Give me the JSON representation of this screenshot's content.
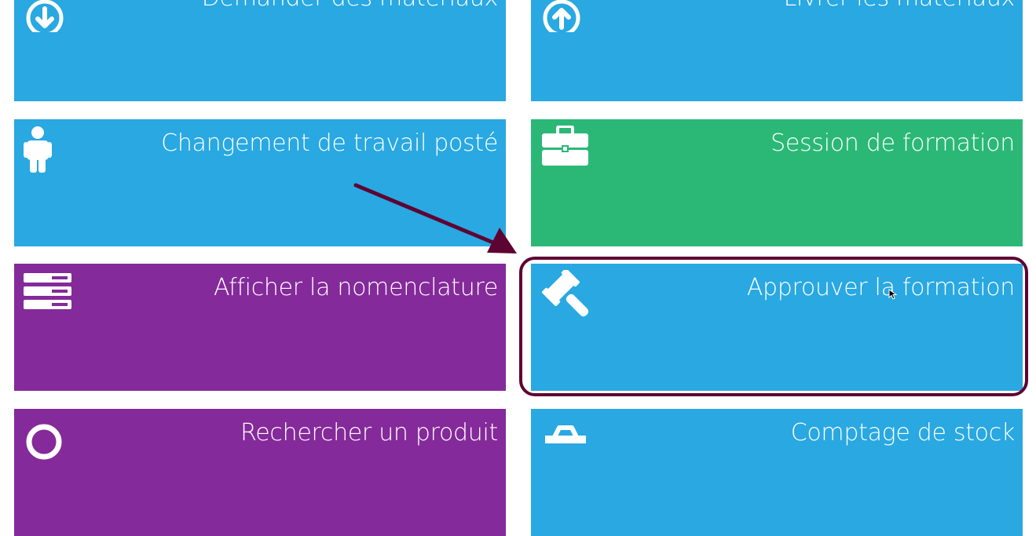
{
  "tiles": [
    {
      "label": "Demander des matériaux",
      "icon": "download-circle-icon",
      "color": "#29a8e2"
    },
    {
      "label": "Livrer les matériaux",
      "icon": "upload-circle-icon",
      "color": "#29a8e2"
    },
    {
      "label": "Changement de travail posté",
      "icon": "person-icon",
      "color": "#29a8e2"
    },
    {
      "label": "Session de formation",
      "icon": "briefcase-icon",
      "color": "#2bb877"
    },
    {
      "label": "Afficher la nomenclature",
      "icon": "server-stack-icon",
      "color": "#842a9a"
    },
    {
      "label": "Approuver la formation",
      "icon": "gavel-icon",
      "color": "#29a8e2"
    },
    {
      "label": "Rechercher un produit",
      "icon": "search-icon",
      "color": "#842a9a"
    },
    {
      "label": "Comptage de stock",
      "icon": "basket-icon",
      "color": "#29a8e2"
    }
  ],
  "annotation": {
    "arrow_color": "#5e0432",
    "highlight_color": "#5e0432"
  }
}
